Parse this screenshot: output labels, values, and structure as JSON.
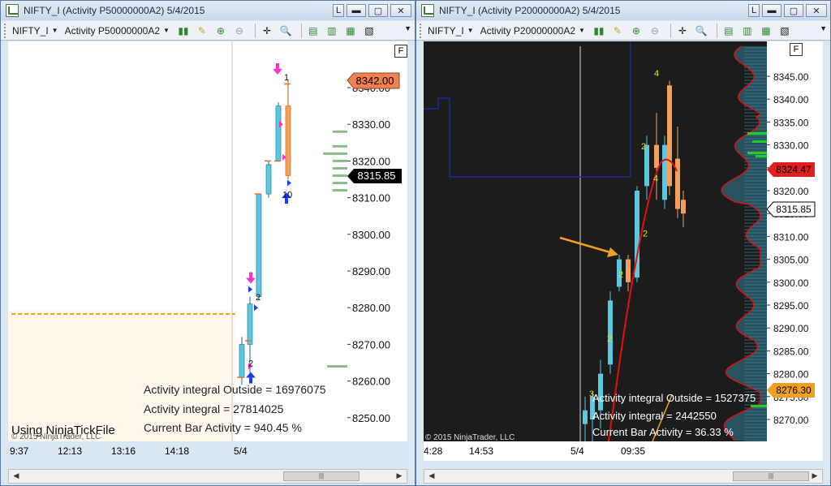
{
  "left": {
    "title": "NIFTY_I (Activity P50000000A2)  5/4/2015",
    "toolbar": {
      "instrument": "NIFTY_I",
      "period": "Activity P50000000A2"
    },
    "f_label": "F",
    "prices": [
      "8340.00",
      "8330.00",
      "8320.00",
      "8310.00",
      "8300.00",
      "8290.00",
      "8280.00",
      "8270.00",
      "8260.00",
      "8250.00"
    ],
    "current_high_label": "8342.00",
    "current_price_label": "8315.85",
    "times": [
      "9:37",
      "12:13",
      "13:16",
      "14:18",
      "5/4"
    ],
    "info": {
      "outside": "Activity integral Outside  = 16976075",
      "integral": "Activity integral = 27814025",
      "current": "Current Bar Activity = 940.45 %"
    },
    "watermark": "Using NinjaTickFile",
    "copyright": "© 2015 NinjaTrader, LLC",
    "bar_labels": [
      "2",
      "2",
      "1",
      "10"
    ],
    "colors": {
      "up": "#5bc8e0",
      "down": "#f4a05a",
      "pink": "#ff33cc",
      "blue": "#1a3cff",
      "dashed": "#f0a020",
      "volume": "#8cbc8c",
      "price_tag_high": "#f08050"
    }
  },
  "right": {
    "title": "NIFTY_I (Activity P20000000A2)  5/4/2015",
    "toolbar": {
      "instrument": "NIFTY_I",
      "period": "Activity P20000000A2"
    },
    "f_label": "F",
    "prices": [
      "8345.00",
      "8340.00",
      "8335.00",
      "8330.00",
      "8325.00",
      "8320.00",
      "8315.00",
      "8310.00",
      "8305.00",
      "8300.00",
      "8295.00",
      "8290.00",
      "8285.00",
      "8280.00",
      "8275.00",
      "8270.00"
    ],
    "tag_high": "8324.47",
    "tag_price": "8315.85",
    "tag_low": "8276.30",
    "times": [
      "4:28",
      "14:53",
      "5/4",
      "09:35"
    ],
    "info": {
      "outside": "Activity integral Outside  = 1527375",
      "integral": "Activity integral = 2442550",
      "current": "Current Bar Activity = 36.33 %"
    },
    "copyright": "© 2015 NinjaTrader, LLC",
    "bar_labels": [
      "4",
      "2",
      "4",
      "2",
      "2",
      "2",
      "3"
    ],
    "colors": {
      "bg": "#1c1c1c",
      "up": "#5bc8e0",
      "down": "#f4a05a",
      "ma": "#e01010",
      "navy": "#1a2a9a",
      "profile_fill": "#2a5a6a",
      "profile_line": "#e01010",
      "green": "#22cc22",
      "arrow": "#f0a020",
      "tag_high": "#e02020",
      "tag_low": "#f0a020"
    }
  }
}
